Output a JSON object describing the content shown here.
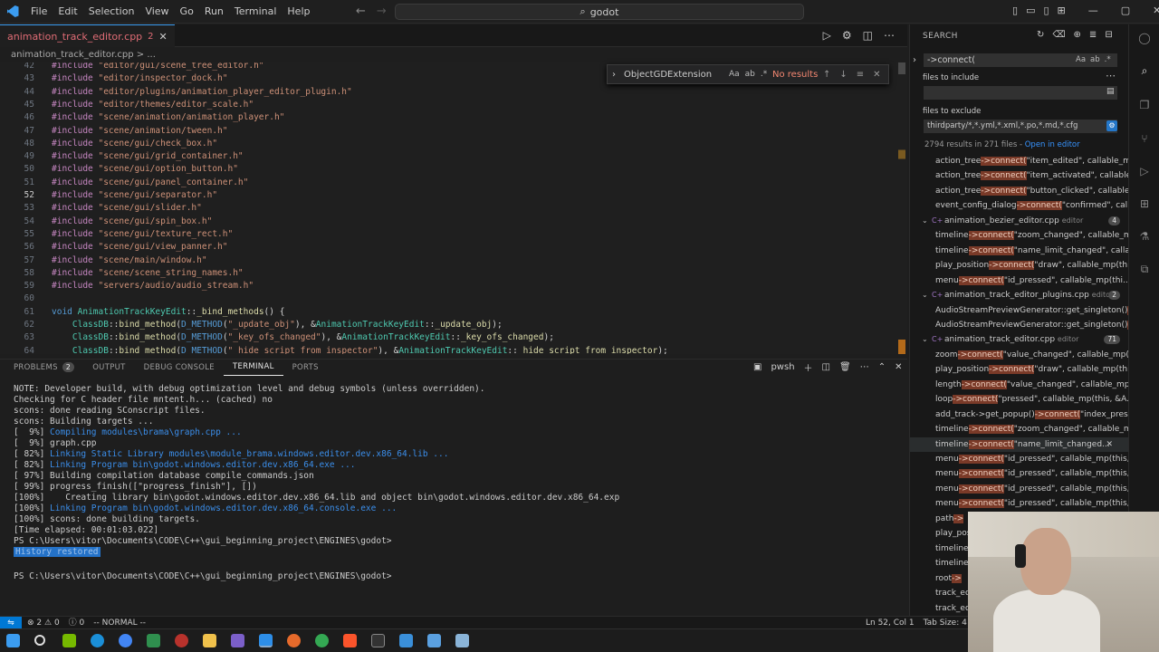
{
  "titlebar": {
    "menu": [
      "File",
      "Edit",
      "Selection",
      "View",
      "Go",
      "Run",
      "Terminal",
      "Help"
    ],
    "search": "godot"
  },
  "editor": {
    "tab": {
      "name": "animation_track_editor.cpp",
      "problems": "2"
    },
    "breadcrumb": "animation_track_editor.cpp > ...",
    "find": {
      "query": "ObjectGDExtension",
      "result": "No results",
      "opts": [
        "Aa",
        "ab",
        ".*"
      ]
    },
    "lines": [
      {
        "n": "42",
        "code": "#include \"editor/gui/scene_tree_editor.h\""
      },
      {
        "n": "43",
        "code": "#include \"editor/inspector_dock.h\""
      },
      {
        "n": "44",
        "code": "#include \"editor/plugins/animation_player_editor_plugin.h\""
      },
      {
        "n": "45",
        "code": "#include \"editor/themes/editor_scale.h\""
      },
      {
        "n": "46",
        "code": "#include \"scene/animation/animation_player.h\""
      },
      {
        "n": "47",
        "code": "#include \"scene/animation/tween.h\""
      },
      {
        "n": "48",
        "code": "#include \"scene/gui/check_box.h\""
      },
      {
        "n": "49",
        "code": "#include \"scene/gui/grid_container.h\""
      },
      {
        "n": "50",
        "code": "#include \"scene/gui/option_button.h\""
      },
      {
        "n": "51",
        "code": "#include \"scene/gui/panel_container.h\""
      },
      {
        "n": "52",
        "code": "#include \"scene/gui/separator.h\""
      },
      {
        "n": "53",
        "code": "#include \"scene/gui/slider.h\""
      },
      {
        "n": "54",
        "code": "#include \"scene/gui/spin_box.h\""
      },
      {
        "n": "55",
        "code": "#include \"scene/gui/texture_rect.h\""
      },
      {
        "n": "56",
        "code": "#include \"scene/gui/view_panner.h\""
      },
      {
        "n": "57",
        "code": "#include \"scene/main/window.h\""
      },
      {
        "n": "58",
        "code": "#include \"scene/scene_string_names.h\""
      },
      {
        "n": "59",
        "code": "#include \"servers/audio/audio_stream.h\""
      },
      {
        "n": "60",
        "code": ""
      },
      {
        "n": "61",
        "code": "void AnimationTrackKeyEdit::_bind_methods() {"
      },
      {
        "n": "62",
        "code": "    ClassDB::bind_method(D_METHOD(\"_update_obj\"), &AnimationTrackKeyEdit::_update_obj);"
      },
      {
        "n": "63",
        "code": "    ClassDB::bind_method(D_METHOD(\"_key_ofs_changed\"), &AnimationTrackKeyEdit::_key_ofs_changed);"
      },
      {
        "n": "64",
        "code": "    ClassDB::bind_method(D_METHOD(\"_hide_script_from_inspector\"), &AnimationTrackKeyEdit::_hide_script_from_inspector);"
      }
    ]
  },
  "panel": {
    "tabs": [
      "PROBLEMS",
      "OUTPUT",
      "DEBUG CONSOLE",
      "TERMINAL",
      "PORTS"
    ],
    "problems_count": "2",
    "shell": "pwsh",
    "terminal": [
      "NOTE: Developer build, with debug optimization level and debug symbols (unless overridden).",
      "Checking for C header file mntent.h... (cached) no",
      "scons: done reading SConscript files.",
      "scons: Building targets ...",
      "[  9%] Compiling modules\\brama\\graph.cpp ...",
      "[  9%] graph.cpp",
      "[ 82%] Linking Static Library modules\\module_brama.windows.editor.dev.x86_64.lib ...",
      "[ 82%] Linking Program bin\\godot.windows.editor.dev.x86_64.exe ...",
      "[ 97%] Building compilation database compile_commands.json",
      "[ 99%] progress_finish([\"progress_finish\"], [])",
      "[100%]    Creating library bin\\godot.windows.editor.dev.x86_64.lib and object bin\\godot.windows.editor.dev.x86_64.exp",
      "[100%] Linking Program bin\\godot.windows.editor.dev.x86_64.console.exe ...",
      "[100%] scons: done building targets.",
      "[Time elapsed: 00:01:03.022]",
      "PS C:\\Users\\vitor\\Documents\\CODE\\C++\\gui_beginning_project\\ENGINES\\godot>",
      "History restored",
      "PS C:\\Users\\vitor\\Documents\\CODE\\C++\\gui_beginning_project\\ENGINES\\godot>"
    ]
  },
  "status": {
    "errors": "2",
    "warnings": "0",
    "info": "0",
    "mode": "-- NORMAL --",
    "cursor": "Ln 52, Col 1",
    "indent": "Tab Size: 4"
  },
  "search": {
    "title": "SEARCH",
    "query": "->connect(",
    "include_label": "files to include",
    "exclude_label": "files to exclude",
    "exclude_value": "thirdparty/*,*.yml,*.xml,*.po,*.md,*.cfg",
    "summary": "2794 results in 271 files -",
    "open_in_editor": "Open in editor",
    "results": [
      {
        "kind": "match",
        "pre": "action_tree",
        "hl": "->connect(",
        "post": "\"item_edited\", callable_m..."
      },
      {
        "kind": "match",
        "pre": "action_tree",
        "hl": "->connect(",
        "post": "\"item_activated\", callable..."
      },
      {
        "kind": "match",
        "pre": "action_tree",
        "hl": "->connect(",
        "post": "\"button_clicked\", callable..."
      },
      {
        "kind": "match",
        "pre": "event_config_dialog",
        "hl": "->connect(",
        "post": "\"confirmed\", call..."
      },
      {
        "kind": "file",
        "name": "animation_bezier_editor.cpp",
        "dir": "editor",
        "count": "4"
      },
      {
        "kind": "match",
        "pre": "timeline",
        "hl": "->connect(",
        "post": "\"zoom_changed\", callable_m..."
      },
      {
        "kind": "match",
        "pre": "timeline",
        "hl": "->connect(",
        "post": "\"name_limit_changed\", calla..."
      },
      {
        "kind": "match",
        "pre": "play_position",
        "hl": "->connect(",
        "post": "\"draw\", callable_mp(thi..."
      },
      {
        "kind": "match",
        "pre": "menu",
        "hl": "->connect(",
        "post": "\"id_pressed\", callable_mp(thi..."
      },
      {
        "kind": "file",
        "name": "animation_track_editor_plugins.cpp",
        "dir": "editor",
        "count": "2"
      },
      {
        "kind": "match",
        "pre": "AudioStreamPreviewGenerator::get_singleton()",
        "hl": "->",
        "post": ""
      },
      {
        "kind": "match",
        "pre": "AudioStreamPreviewGenerator::get_singleton()",
        "hl": "->",
        "post": ""
      },
      {
        "kind": "file",
        "name": "animation_track_editor.cpp",
        "dir": "editor",
        "count": "71"
      },
      {
        "kind": "match",
        "pre": "zoom",
        "hl": "->connect(",
        "post": "\"value_changed\", callable_mp(t..."
      },
      {
        "kind": "match",
        "pre": "play_position",
        "hl": "->connect(",
        "post": "\"draw\", callable_mp(thi..."
      },
      {
        "kind": "match",
        "pre": "length",
        "hl": "->connect(",
        "post": "\"value_changed\", callable_mp(..."
      },
      {
        "kind": "match",
        "pre": "loop",
        "hl": "->connect(",
        "post": "\"pressed\", callable_mp(this, &A..."
      },
      {
        "kind": "match",
        "pre": "add_track->get_popup()",
        "hl": "->connect(",
        "post": "\"index_pres..."
      },
      {
        "kind": "match",
        "pre": "timeline",
        "hl": "->connect(",
        "post": "\"zoom_changed\", callable_m..."
      },
      {
        "kind": "match",
        "pre": "timeline",
        "hl": "->connect(",
        "post": "\"name_limit_changed...",
        "selected": true
      },
      {
        "kind": "match",
        "pre": "menu",
        "hl": "->connect(",
        "post": "\"id_pressed\", callable_mp(this, ..."
      },
      {
        "kind": "match",
        "pre": "menu",
        "hl": "->connect(",
        "post": "\"id_pressed\", callable_mp(this, ..."
      },
      {
        "kind": "match",
        "pre": "menu",
        "hl": "->connect(",
        "post": "\"id_pressed\", callable_mp(this, ..."
      },
      {
        "kind": "match",
        "pre": "menu",
        "hl": "->connect(",
        "post": "\"id_pressed\", callable_mp(this, ..."
      },
      {
        "kind": "match",
        "pre": "path",
        "hl": "->",
        "post": ""
      },
      {
        "kind": "match",
        "pre": "play_pos",
        "hl": "",
        "post": ""
      },
      {
        "kind": "match",
        "pre": "timeline",
        "hl": "",
        "post": ""
      },
      {
        "kind": "match",
        "pre": "timeline",
        "hl": "",
        "post": ""
      },
      {
        "kind": "match",
        "pre": "root",
        "hl": "->",
        "post": ""
      },
      {
        "kind": "match",
        "pre": "track_edi",
        "hl": "",
        "post": ""
      },
      {
        "kind": "match",
        "pre": "track_edi",
        "hl": "",
        "post": ""
      }
    ]
  }
}
